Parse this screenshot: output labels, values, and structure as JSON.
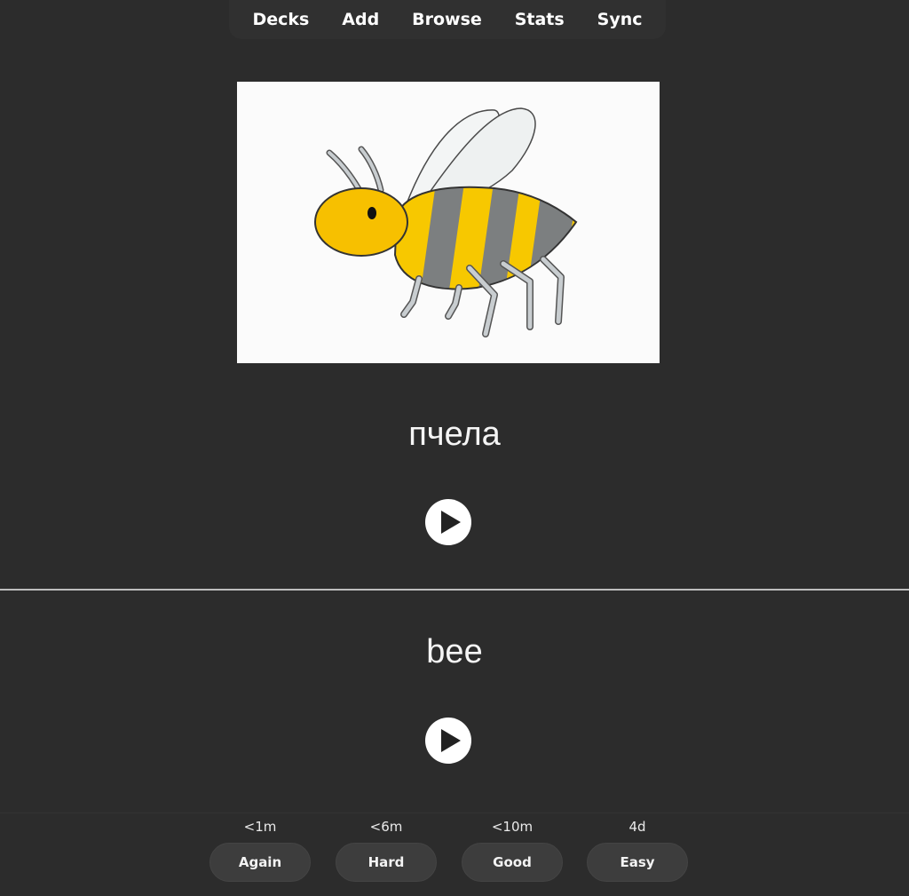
{
  "nav": {
    "items": [
      {
        "label": "Decks"
      },
      {
        "label": "Add"
      },
      {
        "label": "Browse"
      },
      {
        "label": "Stats"
      },
      {
        "label": "Sync"
      }
    ]
  },
  "card": {
    "image_icon": "bee-illustration",
    "front_word": "пчела",
    "back_word": "bee",
    "audio_icon": "play-icon"
  },
  "answer_buttons": [
    {
      "interval": "<1m",
      "label": "Again"
    },
    {
      "interval": "<6m",
      "label": "Hard"
    },
    {
      "interval": "<10m",
      "label": "Good"
    },
    {
      "interval": "4d",
      "label": "Easy"
    }
  ],
  "colors": {
    "background": "#2c2c2c",
    "bee_yellow": "#f7c800",
    "bee_stripe": "#7c7f80",
    "divider": "#bdbdbd"
  }
}
